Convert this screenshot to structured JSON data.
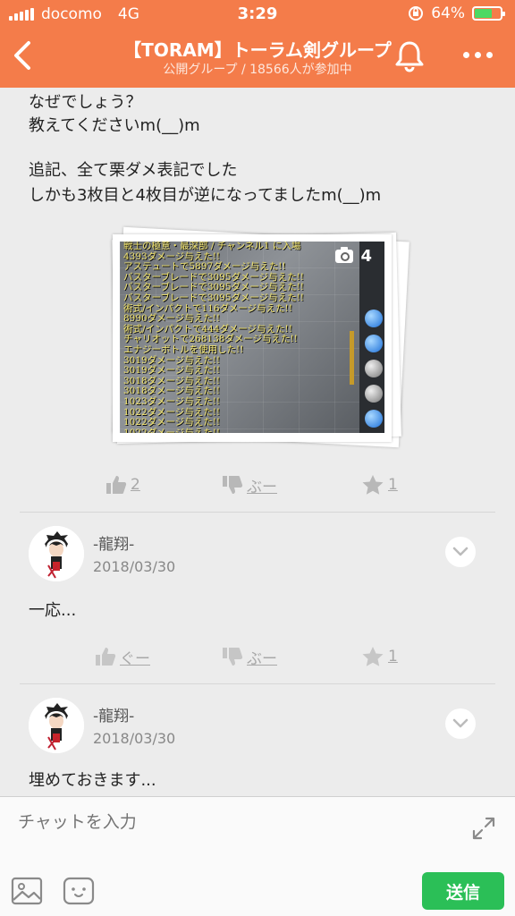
{
  "status_bar": {
    "carrier": "docomo",
    "network": "4G",
    "time": "3:29",
    "battery": "64%",
    "battery_level": 0.64
  },
  "header": {
    "title": "【TORAM】トーラム剣グループ",
    "subtitle": "公開グループ / 18566人が参加中",
    "back_icon": "chevron-left-icon",
    "bell_icon": "bell-icon",
    "more_icon": "more-dots-icon"
  },
  "post": {
    "lines": [
      "なぜでしょう？",
      "教えてくださいm(__)m",
      "",
      "追記、全て栗ダメ表記でした",
      "しかも3枚目と4枚目が逆になってましたm(__)m"
    ],
    "photo_count": "4",
    "screenshot_log": [
      "戦士の極意・最深部 / チャンネル1 に入場",
      "4393ダメージ与えた!!",
      "アステュートで5897ダメージ与えた!!",
      "バスターブレードで3095ダメージ与えた!!",
      "バスターブレードで3095ダメージ与えた!!",
      "バスターブレードで3095ダメージ与えた!!",
      "術式/インパクトで116ダメージ与えた!!",
      "8990ダメージ与えた!!",
      "術式/インパクトで444ダメージ与えた!!",
      "チャリオットで268138ダメージ与えた!!",
      "エナジーボトルを使用した!!",
      "3019ダメージ与えた!!",
      "3019ダメージ与えた!!",
      "3018ダメージ与えた!!",
      "3018ダメージ与えた!!",
      "1023ダメージ与えた!!",
      "1022ダメージ与えた!!",
      "1022ダメージ与えた!!",
      "1022ダメージ与えた!!",
      "術式/インパクトで281ダメージ与えた!!"
    ],
    "actions": {
      "like": "2",
      "dislike": "ぶー",
      "favorite": "1"
    }
  },
  "comments": [
    {
      "name": "-龍翔-",
      "date": "2018/03/30",
      "text": "一応...",
      "actions": {
        "like": "ぐー",
        "dislike": "ぶー",
        "favorite": "1"
      }
    },
    {
      "name": "-龍翔-",
      "date": "2018/03/30",
      "text": "埋めておきます..."
    }
  ],
  "composer": {
    "placeholder": "チャットを入力",
    "send_label": "送信"
  },
  "colors": {
    "header": "#f47c4a",
    "send": "#2bbf57",
    "background": "#ececec"
  }
}
